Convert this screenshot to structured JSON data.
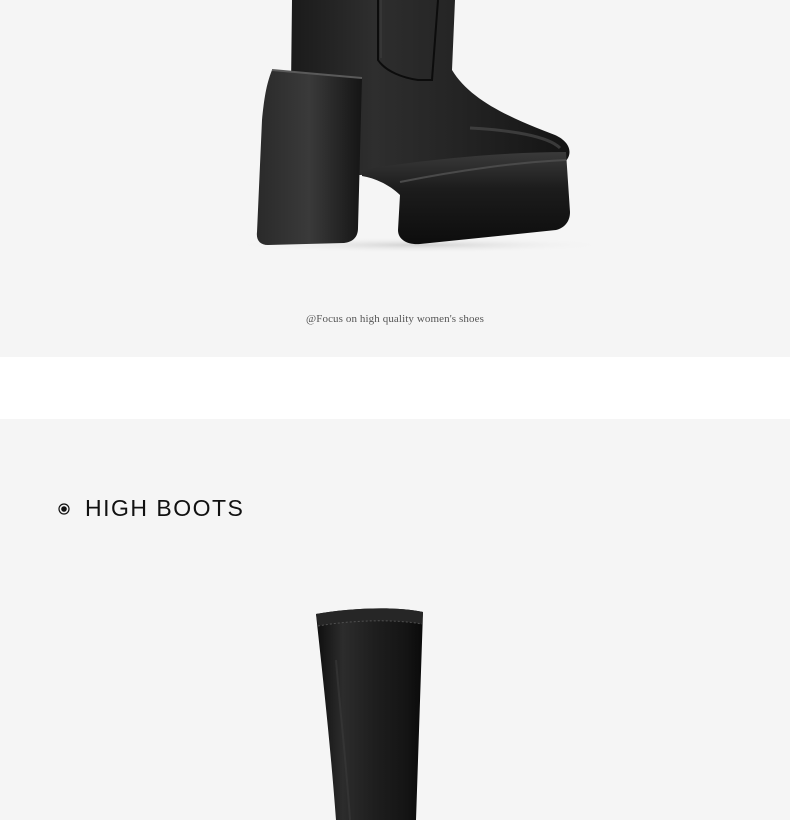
{
  "caption": "@Focus on high quality women's shoes",
  "section": {
    "title": "HIGH BOOTS",
    "bullet_icon": "radio-dot-icon"
  },
  "images": {
    "top": "platform-ankle-boot-image",
    "bottom": "high-boot-image"
  },
  "colors": {
    "panel_bg": "#f5f5f5",
    "separator_bg": "#ffffff",
    "boot": "#1a1a1a",
    "text": "#111111",
    "caption_text": "#555555"
  }
}
